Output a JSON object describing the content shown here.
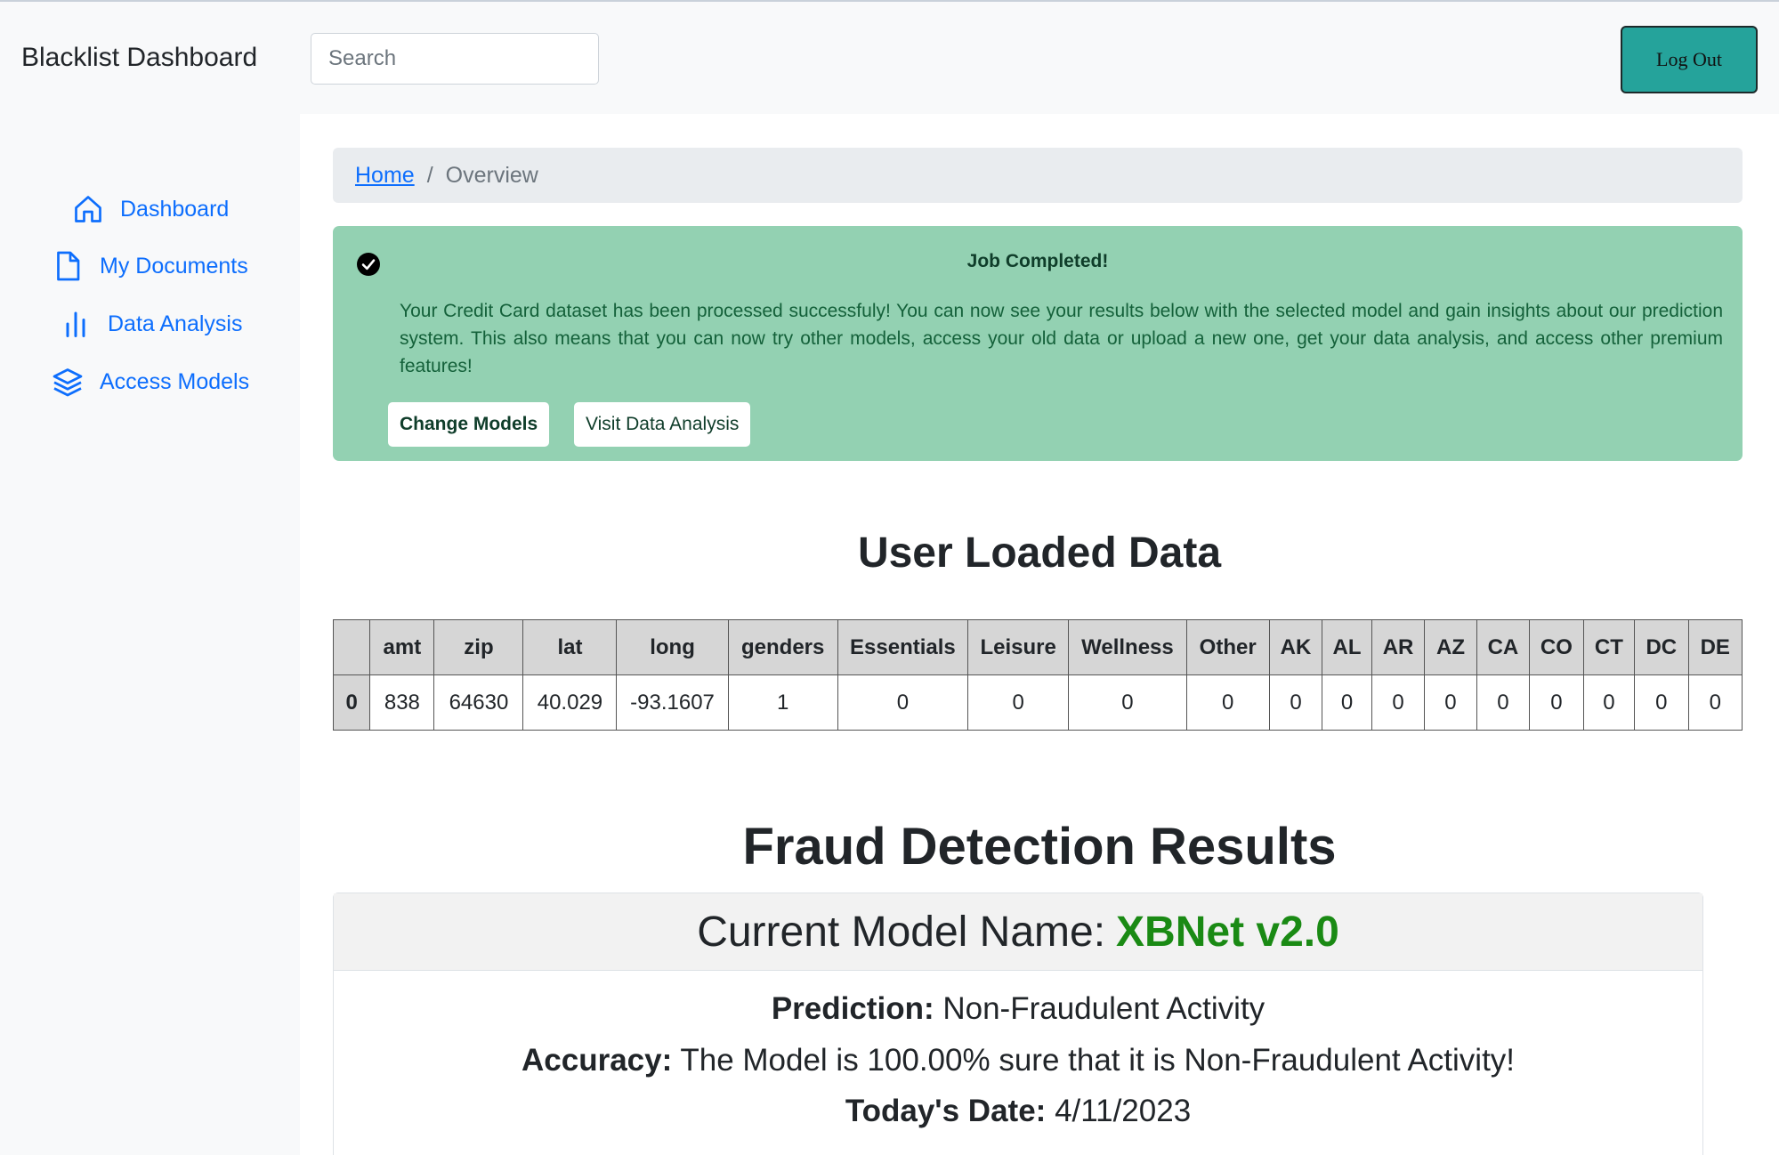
{
  "header": {
    "brand": "Blacklist Dashboard",
    "search_placeholder": "Search",
    "logout_label": "Log Out"
  },
  "sidebar": {
    "items": [
      {
        "label": "Dashboard",
        "icon": "home-icon"
      },
      {
        "label": "My Documents",
        "icon": "file-icon"
      },
      {
        "label": "Data Analysis",
        "icon": "bar-chart-icon"
      },
      {
        "label": "Access Models",
        "icon": "layers-icon"
      }
    ]
  },
  "breadcrumb": {
    "home": "Home",
    "separator": "/",
    "current": "Overview"
  },
  "alert": {
    "title": "Job Completed!",
    "message": "Your Credit Card dataset has been processed successfuly! You can now see your results below with the selected model and gain insights about our prediction system. This also means that you can now try other models, access your old data or upload a new one, get your data analysis, and access other premium features!",
    "change_models": "Change Models",
    "visit_analysis": "Visit Data Analysis"
  },
  "user_data": {
    "heading": "User Loaded Data",
    "columns": [
      "",
      "amt",
      "zip",
      "lat",
      "long",
      "genders",
      "Essentials",
      "Leisure",
      "Wellness",
      "Other",
      "AK",
      "AL",
      "AR",
      "AZ",
      "CA",
      "CO",
      "CT",
      "DC",
      "DE"
    ],
    "rows": [
      [
        "0",
        "838",
        "64630",
        "40.029",
        "-93.1607",
        "1",
        "0",
        "0",
        "0",
        "0",
        "0",
        "0",
        "0",
        "0",
        "0",
        "0",
        "0",
        "0",
        "0"
      ]
    ]
  },
  "results": {
    "heading": "Fraud Detection Results",
    "model_label": "Current Model Name:",
    "model_name": "XBNet v2.0",
    "prediction_label": "Prediction:",
    "prediction_value": "Non-Fraudulent Activity",
    "accuracy_label": "Accuracy:",
    "accuracy_value": "The Model is 100.00% sure that it is Non-Fraudulent Activity!",
    "date_label": "Today's Date:",
    "date_value": "4/11/2023"
  },
  "colors": {
    "accent": "#0d6efd",
    "success_bg": "#93d1b2",
    "logout_bg": "#25a39b",
    "model_green": "#1a8a14"
  }
}
